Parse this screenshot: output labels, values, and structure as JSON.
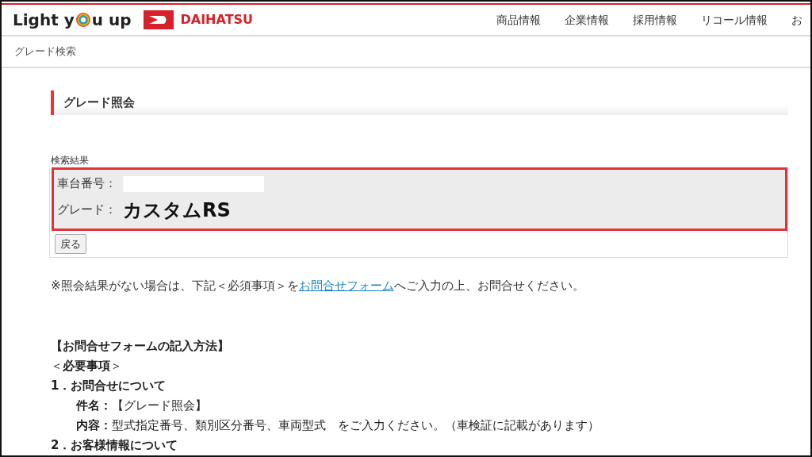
{
  "header": {
    "logo_before": "Light y",
    "logo_after": "u up",
    "brand": "DAIHATSU",
    "nav": [
      "商品情報",
      "企業情報",
      "採用情報",
      "リコール情報",
      "お"
    ]
  },
  "breadcrumb": "グレード検索",
  "heading": "グレード照会",
  "result": {
    "caption": "検索結果",
    "fields": [
      {
        "label": "車台番号：",
        "kind": "masked"
      },
      {
        "label": "グレード：",
        "kind": "value",
        "value": "カスタムRS"
      }
    ],
    "back_button": "戻る"
  },
  "note": {
    "before": "※照会結果がない場合は、下記＜必須事項＞を",
    "link": "お問合せフォーム",
    "after": "へご入力の上、お問合せください。"
  },
  "instructions": [
    {
      "kind": "title",
      "text": "【お問合せフォームの記入方法】"
    },
    {
      "kind": "line",
      "text": "＜**必要事項**＞"
    },
    {
      "kind": "item",
      "text": "1．お問合せについて"
    },
    {
      "kind": "sub",
      "text": "**件名：**【グレード照会】"
    },
    {
      "kind": "sub",
      "text": "**内容：**型式指定番号、類別区分番号、車両型式　をご入力ください。（車検証に記載があります）"
    },
    {
      "kind": "item",
      "text": "2．お客様情報について"
    }
  ]
}
